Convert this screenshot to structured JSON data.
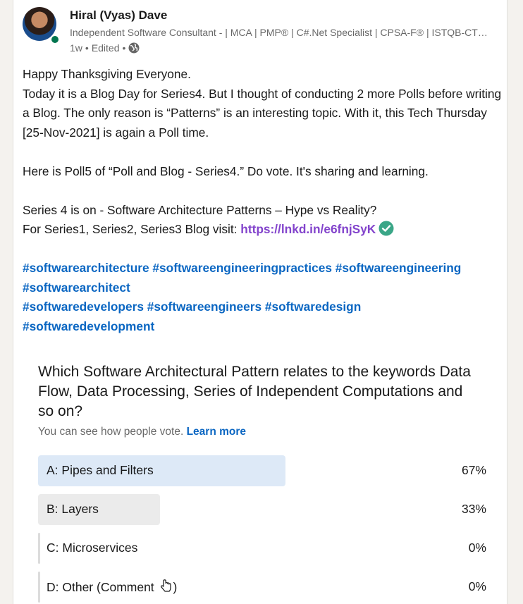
{
  "post": {
    "author": "Hiral (Vyas) Dave",
    "headline": "Independent Software Consultant - | MCA | PMP® | C#.Net Specialist | CPSA-F® | ISTQB-CTFL | Microsoft Certified Trainer",
    "time": "1w",
    "edited": "Edited",
    "visibility_icon": "globe-icon",
    "online_color": "#01754f",
    "body": {
      "line1": "Happy Thanksgiving Everyone.",
      "line2": "Today it is a Blog Day for Series4. But I thought of conducting 2 more Polls before writing a Blog. The only reason is “Patterns” is an interesting topic. With it, this Tech Thursday [25-Nov-2021] is again a Poll time.",
      "line3": "Here is Poll5 of “Poll and Blog - Series4.” Do vote. It's sharing and learning.",
      "line4": "Series 4 is on - Software Architecture Patterns – Hype vs Reality?",
      "line5_prefix": "For Series1, Series2, Series3 Blog visit: ",
      "link": "https://lnkd.in/e6fnjSyK",
      "link_color": "#8344cc",
      "check_icon": "check-circle-icon"
    },
    "hashtags": [
      "#softwarearchitecture",
      "#softwareengineeringpractices",
      "#softwareengineering",
      "#softwarearchitect",
      "#softwaredevelopers",
      "#softwareengineers",
      "#softwaredesign",
      "#softwaredevelopment"
    ],
    "hashtag_color": "#0a66c2"
  },
  "poll": {
    "question": "Which Software Architectural Pattern relates to the keywords Data Flow, Data Processing, Series of Independent Computations and so on?",
    "subtitle": "You can see how people vote.",
    "learn_more": "Learn more",
    "options": [
      {
        "label": "A: Pipes and Filters",
        "percent_text": "67%",
        "percent": 67,
        "winner": true
      },
      {
        "label": "B: Layers",
        "percent_text": "33%",
        "percent": 33,
        "winner": false
      },
      {
        "label": "C: Microservices",
        "percent_text": "0%",
        "percent": 0,
        "winner": false
      },
      {
        "label": "D: Other (Comment ",
        "percent_text": "0%",
        "percent": 0,
        "winner": false,
        "icon": "hand-pointing-down-icon",
        "suffix": ")"
      }
    ],
    "colors": {
      "winner_bar": "#dde9f7",
      "bar": "#ebebeb"
    }
  }
}
